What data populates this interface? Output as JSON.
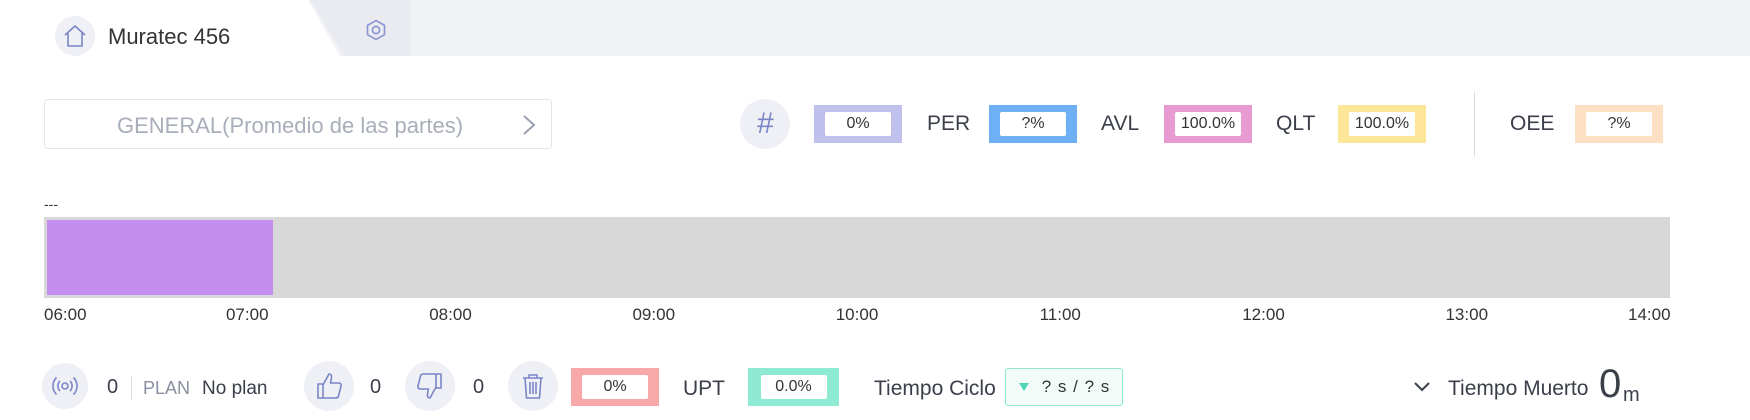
{
  "header": {
    "title": "Muratec 456",
    "tab_settings_icon": "hexagon-nut-icon",
    "home_icon": "home-icon"
  },
  "selector": {
    "label": "GENERAL(Promedio de las partes)",
    "icon": "chevron-right-icon"
  },
  "kpis": {
    "count_icon": "hash-icon",
    "count_value": "0%",
    "count_color": "#c0c0ec",
    "per_label": "PER",
    "per_value": "?%",
    "per_color": "#6eb0f5",
    "avl_label": "AVL",
    "avl_value": "100.0%",
    "avl_color": "#e89ad2",
    "qlt_label": "QLT",
    "qlt_value": "100.0%",
    "qlt_color": "#fde59a",
    "oee_label": "OEE",
    "oee_value": "?%",
    "oee_color": "#fde0c4"
  },
  "timeline": {
    "caption": "---",
    "start": "06:00",
    "end": "14:00",
    "ticks": [
      "06:00",
      "07:00",
      "08:00",
      "09:00",
      "10:00",
      "11:00",
      "12:00",
      "13:00",
      "14:00"
    ],
    "segments": [
      {
        "from_hours": 0.0,
        "to_hours": 1.11,
        "color": "#c48ef0"
      }
    ],
    "background_color": "#d8d8d8"
  },
  "footer": {
    "signal_icon": "broadcast-icon",
    "signal_count": "0",
    "plan_label": "PLAN",
    "plan_value": "No plan",
    "good_icon": "thumbs-up-icon",
    "good_count": "0",
    "bad_icon": "thumbs-down-icon",
    "bad_count": "0",
    "trash_icon": "trash-icon",
    "scrap_value": "0%",
    "scrap_color": "#f8a8a8",
    "upt_label": "UPT",
    "upt_value": "0.0%",
    "upt_color": "#8eead2",
    "cycle_label": "Tiempo Ciclo",
    "cycle_value": "? s / ? s",
    "cycle_icon": "triangle-down-icon",
    "dead_time_label": "Tiempo Muerto",
    "dead_time_value": "0",
    "dead_time_unit": "m",
    "dead_time_icon": "chevron-down-icon"
  }
}
